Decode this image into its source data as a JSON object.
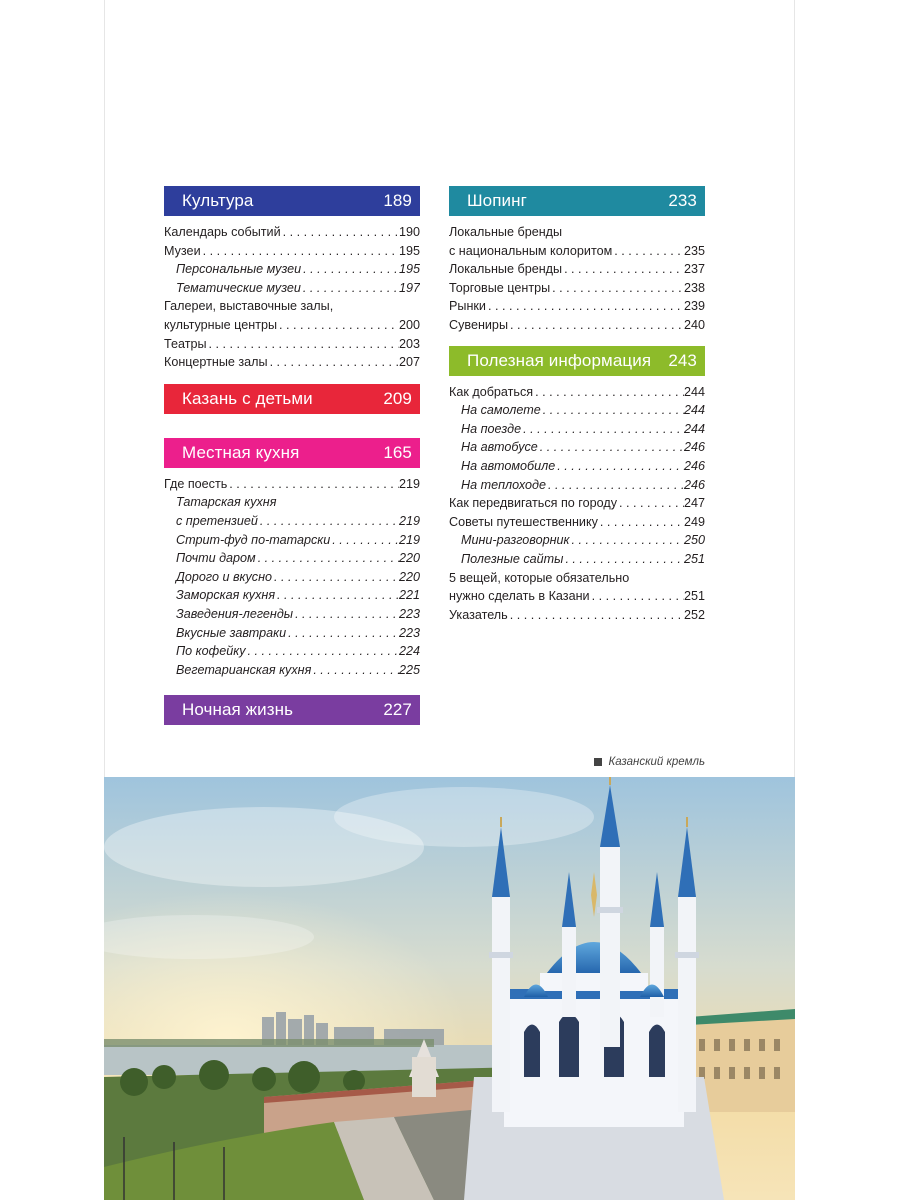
{
  "colors": {
    "culture": "#2e3e9c",
    "kids": "#e8263a",
    "cuisine": "#ec1f8c",
    "nightlife": "#7a3da0",
    "shopping": "#1f8aa0",
    "info": "#8dbb2a"
  },
  "left": {
    "culture": {
      "title": "Культура",
      "page": "189",
      "entries": [
        {
          "text": "Календарь событий",
          "page": "190"
        },
        {
          "text": "Музеи",
          "page": "195"
        },
        {
          "text": "Персональные музеи",
          "page": "195",
          "sub": true
        },
        {
          "text": "Тематические музеи",
          "page": "197",
          "sub": true
        },
        {
          "text_line1": "Галереи, выставочные залы,",
          "text": "культурные центры",
          "page": "200"
        },
        {
          "text": "Театры",
          "page": "203"
        },
        {
          "text": "Концертные залы",
          "page": "207"
        }
      ]
    },
    "kids": {
      "title": "Казань с детьми",
      "page": "209"
    },
    "cuisine": {
      "title": "Местная кухня",
      "page": "165",
      "entries": [
        {
          "text": "Где поесть",
          "page": "219"
        },
        {
          "text_line1": "Татарская кухня",
          "text": "с претензией",
          "page": "219",
          "sub": true
        },
        {
          "text": "Стрит-фуд по-татарски",
          "page": "219",
          "sub": true
        },
        {
          "text": "Почти даром",
          "page": "220",
          "sub": true
        },
        {
          "text": "Дорого и вкусно",
          "page": "220",
          "sub": true
        },
        {
          "text": "Заморская кухня",
          "page": "221",
          "sub": true
        },
        {
          "text": "Заведения-легенды",
          "page": "223",
          "sub": true
        },
        {
          "text": "Вкусные завтраки",
          "page": "223",
          "sub": true
        },
        {
          "text": "По кофейку",
          "page": "224",
          "sub": true
        },
        {
          "text": "Вегетарианская кухня",
          "page": "225",
          "sub": true
        }
      ]
    },
    "nightlife": {
      "title": "Ночная жизнь",
      "page": "227"
    }
  },
  "right": {
    "shopping": {
      "title": "Шопинг",
      "page": "233",
      "entries": [
        {
          "text_line1": "Локальные бренды",
          "text": "с национальным колоритом",
          "page": "235"
        },
        {
          "text": "Локальные бренды",
          "page": "237"
        },
        {
          "text": "Торговые центры",
          "page": "238"
        },
        {
          "text": "Рынки",
          "page": "239"
        },
        {
          "text": "Сувениры",
          "page": "240"
        }
      ]
    },
    "info": {
      "title": "Полезная информация",
      "page": "243",
      "entries": [
        {
          "text": "Как добраться",
          "page": "244"
        },
        {
          "text": "На самолете",
          "page": "244",
          "sub": true
        },
        {
          "text": "На поезде",
          "page": "244",
          "sub": true
        },
        {
          "text": "На автобусе",
          "page": "246",
          "sub": true
        },
        {
          "text": "На автомобиле",
          "page": "246",
          "sub": true
        },
        {
          "text": "На теплоходе",
          "page": "246",
          "sub": true
        },
        {
          "text": "Как передвигаться по городу",
          "page": "247"
        },
        {
          "text": "Советы путешественнику",
          "page": "249"
        },
        {
          "text": "Мини-разговорник",
          "page": "250",
          "sub": true
        },
        {
          "text": "Полезные сайты",
          "page": "251",
          "sub": true
        },
        {
          "text_line1": "5 вещей, которые обязательно",
          "text": "нужно сделать в Казани",
          "page": "251"
        },
        {
          "text": "Указатель",
          "page": "252"
        }
      ]
    }
  },
  "caption": "Казанский кремль"
}
